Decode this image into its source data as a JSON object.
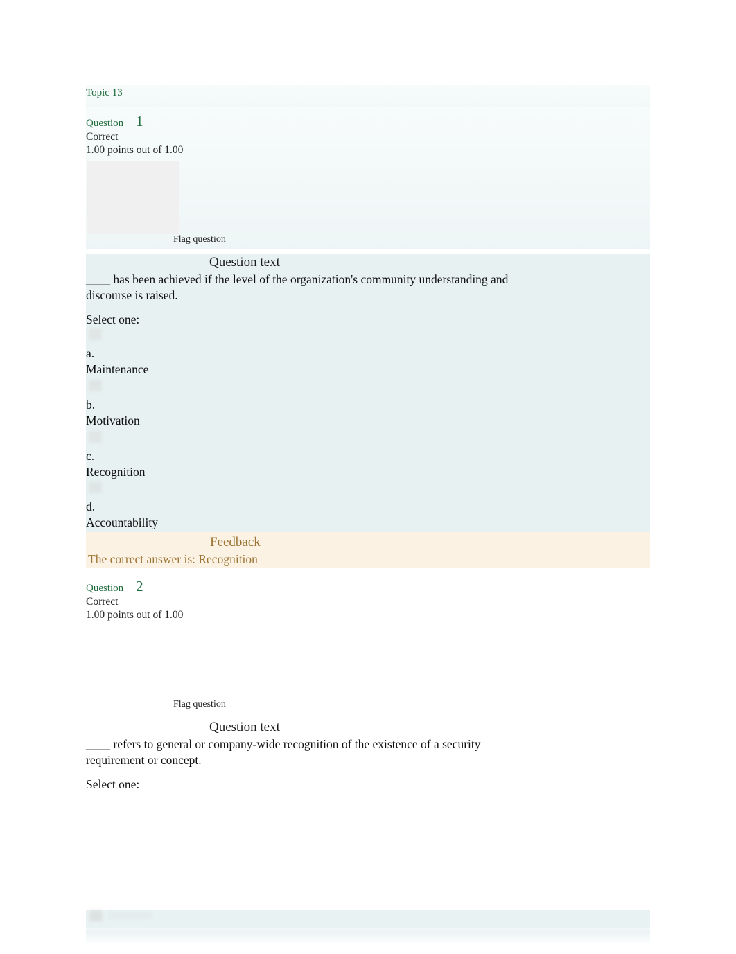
{
  "document": {
    "topic": "Topic 13"
  },
  "colors": {
    "topic_green": "#1f6b3b",
    "question_tint": "#e7f1f2",
    "feedback_tint": "#fbf2e3",
    "feedback_text": "#9c7536",
    "body_text": "#111111",
    "placeholder_gray": "#f0f0f0"
  },
  "labels": {
    "question_word": "Question",
    "flag_question": "Flag question",
    "question_text_heading": "Question text",
    "select_one": "Select one:",
    "feedback_heading": "Feedback"
  },
  "questions": [
    {
      "number": "1",
      "state": "Correct",
      "grade": "1.00 points out of 1.00",
      "flag": "Flag question",
      "text_heading": "Question text",
      "text": "____ has been achieved if the level of the organization's community understanding and discourse is raised.",
      "select_one": "Select one:",
      "options": [
        {
          "letter": "a.",
          "label": "Maintenance"
        },
        {
          "letter": "b.",
          "label": "Motivation"
        },
        {
          "letter": "c.",
          "label": "Recognition"
        },
        {
          "letter": "d.",
          "label": "Accountability"
        }
      ],
      "feedback": {
        "heading": "Feedback",
        "text": "The correct answer is: Recognition"
      }
    },
    {
      "number": "2",
      "state": "Correct",
      "grade": "1.00 points out of 1.00",
      "flag": "Flag question",
      "text_heading": "Question text",
      "text": "____ refers to general or company-wide recognition of the existence of a security requirement or concept.",
      "select_one": "Select one:",
      "options": []
    }
  ]
}
